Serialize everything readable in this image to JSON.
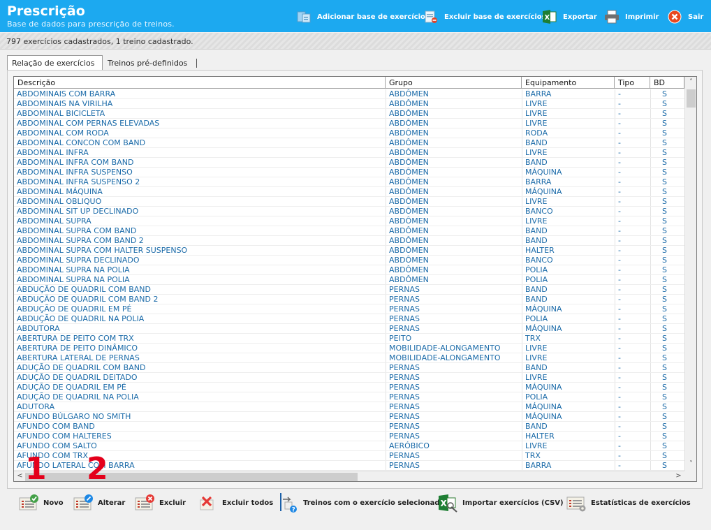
{
  "header": {
    "title": "Prescrição",
    "subtitle": "Base de dados para prescrição de treinos.",
    "buttons": {
      "add_base": "Adicionar base de exercícios",
      "remove_base": "Excluir base de exercícios",
      "export": "Exportar",
      "print": "Imprimir",
      "exit": "Sair"
    }
  },
  "status": "797 exercícios cadastrados, 1 treino cadastrado.",
  "tabs": [
    "Relação de exercícios",
    "Treinos pré-definidos"
  ],
  "columns": [
    "Descrição",
    "Grupo",
    "Equipamento",
    "Tipo",
    "BD"
  ],
  "rows": [
    [
      "ABDOMINAIS COM BARRA",
      "ABDÔMEN",
      "BARRA",
      "-",
      "S"
    ],
    [
      "ABDOMINAIS NA VIRILHA",
      "ABDÔMEN",
      "LIVRE",
      "-",
      "S"
    ],
    [
      "ABDOMINAL BICICLETA",
      "ABDÔMEN",
      "LIVRE",
      "-",
      "S"
    ],
    [
      "ABDOMINAL COM PERNAS ELEVADAS",
      "ABDÔMEN",
      "LIVRE",
      "-",
      "S"
    ],
    [
      "ABDOMINAL COM RODA",
      "ABDÔMEN",
      "RODA",
      "-",
      "S"
    ],
    [
      "ABDOMINAL CONCON COM BAND",
      "ABDÔMEN",
      "BAND",
      "-",
      "S"
    ],
    [
      "ABDOMINAL INFRA",
      "ABDÔMEN",
      "LIVRE",
      "-",
      "S"
    ],
    [
      "ABDOMINAL INFRA COM BAND",
      "ABDÔMEN",
      "BAND",
      "-",
      "S"
    ],
    [
      "ABDOMINAL INFRA SUSPENSO",
      "ABDÔMEN",
      "MÁQUINA",
      "-",
      "S"
    ],
    [
      "ABDOMINAL INFRA SUSPENSO 2",
      "ABDÔMEN",
      "BARRA",
      "-",
      "S"
    ],
    [
      "ABDOMINAL MÁQUINA",
      "ABDÔMEN",
      "MÁQUINA",
      "-",
      "S"
    ],
    [
      "ABDOMINAL OBLIQUO",
      "ABDÔMEN",
      "LIVRE",
      "-",
      "S"
    ],
    [
      "ABDOMINAL SIT UP DECLINADO",
      "ABDÔMEN",
      "BANCO",
      "-",
      "S"
    ],
    [
      "ABDOMINAL SUPRA",
      "ABDÔMEN",
      "LIVRE",
      "-",
      "S"
    ],
    [
      "ABDOMINAL SUPRA COM BAND",
      "ABDÔMEN",
      "BAND",
      "-",
      "S"
    ],
    [
      "ABDOMINAL SUPRA COM BAND 2",
      "ABDÔMEN",
      "BAND",
      "-",
      "S"
    ],
    [
      "ABDOMINAL SUPRA COM HALTER SUSPENSO",
      "ABDÔMEN",
      "HALTER",
      "-",
      "S"
    ],
    [
      "ABDOMINAL SUPRA DECLINADO",
      "ABDÔMEN",
      "BANCO",
      "-",
      "S"
    ],
    [
      "ABDOMINAL SUPRA NA POLIA",
      "ABDÔMEN",
      "POLIA",
      "-",
      "S"
    ],
    [
      "ABDOMINAL SUPRA NA POLIA",
      "ABDÔMEN",
      "POLIA",
      "-",
      "S"
    ],
    [
      "ABDUÇÃO DE QUADRIL COM BAND",
      "PERNAS",
      "BAND",
      "-",
      "S"
    ],
    [
      "ABDUÇÃO DE QUADRIL COM BAND 2",
      "PERNAS",
      "BAND",
      "-",
      "S"
    ],
    [
      "ABDUÇÃO DE QUADRIL EM PÉ",
      "PERNAS",
      "MÁQUINA",
      "-",
      "S"
    ],
    [
      "ABDUÇÃO DE QUADRIL NA POLIA",
      "PERNAS",
      "POLIA",
      "-",
      "S"
    ],
    [
      "ABDUTORA",
      "PERNAS",
      "MÁQUINA",
      "-",
      "S"
    ],
    [
      "ABERTURA DE PEITO COM TRX",
      "PEITO",
      "TRX",
      "-",
      "S"
    ],
    [
      "ABERTURA DE PEITO DINÂMICO",
      "MOBILIDADE-ALONGAMENTO",
      "LIVRE",
      "-",
      "S"
    ],
    [
      "ABERTURA LATERAL DE PERNAS",
      "MOBILIDADE-ALONGAMENTO",
      "LIVRE",
      "-",
      "S"
    ],
    [
      "ADUÇÃO DE QUADRIL COM BAND",
      "PERNAS",
      "BAND",
      "-",
      "S"
    ],
    [
      "ADUÇÃO DE QUADRIL DEITADO",
      "PERNAS",
      "LIVRE",
      "-",
      "S"
    ],
    [
      "ADUÇÃO DE QUADRIL EM PÉ",
      "PERNAS",
      "MÁQUINA",
      "-",
      "S"
    ],
    [
      "ADUÇÃO DE QUADRIL NA POLIA",
      "PERNAS",
      "POLIA",
      "-",
      "S"
    ],
    [
      "ADUTORA",
      "PERNAS",
      "MÁQUINA",
      "-",
      "S"
    ],
    [
      "AFUNDO BÚLGARO NO SMITH",
      "PERNAS",
      "MÁQUINA",
      "-",
      "S"
    ],
    [
      "AFUNDO COM BAND",
      "PERNAS",
      "BAND",
      "-",
      "S"
    ],
    [
      "AFUNDO COM HALTERES",
      "PERNAS",
      "HALTER",
      "-",
      "S"
    ],
    [
      "AFUNDO COM SALTO",
      "AERÓBICO",
      "LIVRE",
      "-",
      "S"
    ],
    [
      "AFUNDO COM TRX",
      "PERNAS",
      "TRX",
      "-",
      "S"
    ],
    [
      "AFUNDO LATERAL COM BARRA",
      "PERNAS",
      "BARRA",
      "-",
      "S"
    ]
  ],
  "toolbar": {
    "new": "Novo",
    "edit": "Alterar",
    "delete": "Excluir",
    "delete_all": "Excluir todos",
    "workouts_with_selected": "Treinos com o exercício selecionado",
    "import_csv": "Importar exercícios (CSV)",
    "stats": "Estatísticas de exercícios"
  },
  "markers": [
    "1",
    "2"
  ]
}
